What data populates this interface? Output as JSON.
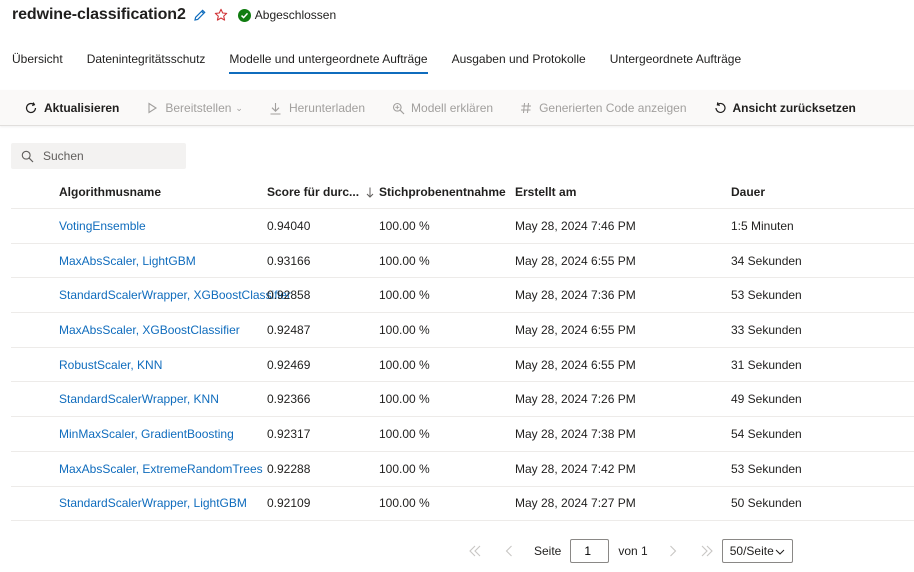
{
  "header": {
    "title": "redwine-classification2",
    "status": "Abgeschlossen"
  },
  "tabs": [
    {
      "label": "Übersicht"
    },
    {
      "label": "Datenintegritätsschutz"
    },
    {
      "label": "Modelle und untergeordnete Aufträge",
      "active": true
    },
    {
      "label": "Ausgaben und Protokolle"
    },
    {
      "label": "Untergeordnete Aufträge"
    }
  ],
  "toolbar": {
    "refresh": "Aktualisieren",
    "deploy": "Bereitstellen",
    "download": "Herunterladen",
    "explain": "Modell erklären",
    "code": "Generierten Code anzeigen",
    "reset": "Ansicht zurücksetzen"
  },
  "search": {
    "placeholder": "Suchen"
  },
  "table": {
    "headers": [
      "Algorithmusname",
      "Score für durc...",
      "Stichprobenentnahme",
      "Erstellt am",
      "Dauer"
    ],
    "rows": [
      [
        "VotingEnsemble",
        "0.94040",
        "100.00 %",
        "May 28, 2024 7:46 PM",
        "1:5 Minuten"
      ],
      [
        "MaxAbsScaler, LightGBM",
        "0.93166",
        "100.00 %",
        "May 28, 2024 6:55 PM",
        "34 Sekunden"
      ],
      [
        "StandardScalerWrapper, XGBoostClassifier",
        "0.92858",
        "100.00 %",
        "May 28, 2024 7:36 PM",
        "53 Sekunden"
      ],
      [
        "MaxAbsScaler, XGBoostClassifier",
        "0.92487",
        "100.00 %",
        "May 28, 2024 6:55 PM",
        "33 Sekunden"
      ],
      [
        "RobustScaler, KNN",
        "0.92469",
        "100.00 %",
        "May 28, 2024 6:55 PM",
        "31 Sekunden"
      ],
      [
        "StandardScalerWrapper, KNN",
        "0.92366",
        "100.00 %",
        "May 28, 2024 7:26 PM",
        "49 Sekunden"
      ],
      [
        "MinMaxScaler, GradientBoosting",
        "0.92317",
        "100.00 %",
        "May 28, 2024 7:38 PM",
        "54 Sekunden"
      ],
      [
        "MaxAbsScaler, ExtremeRandomTrees",
        "0.92288",
        "100.00 %",
        "May 28, 2024 7:42 PM",
        "53 Sekunden"
      ],
      [
        "StandardScalerWrapper, LightGBM",
        "0.92109",
        "100.00 %",
        "May 28, 2024 7:27 PM",
        "50 Sekunden"
      ]
    ]
  },
  "pager": {
    "page_label": "Seite",
    "page": "1",
    "of_label": "von 1",
    "page_size": "50/Seite"
  },
  "colors": {
    "accent": "#0f6cbd",
    "success": "#107c10",
    "favorite": "#d13438"
  }
}
